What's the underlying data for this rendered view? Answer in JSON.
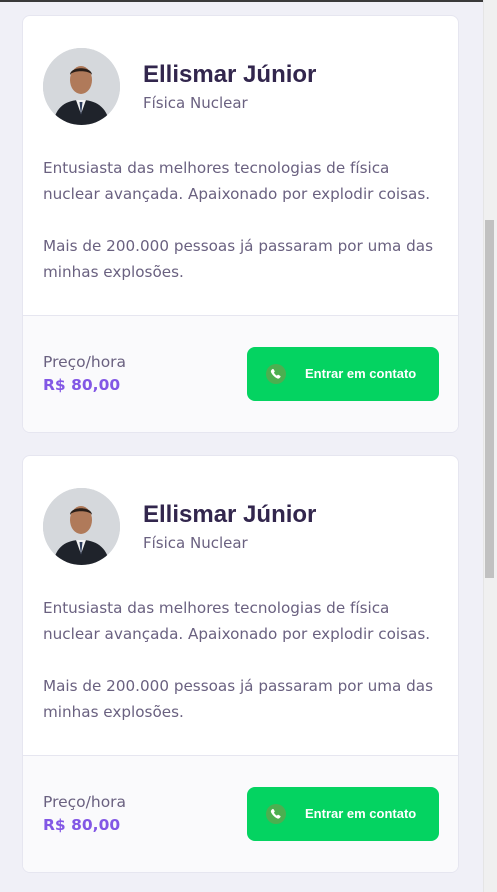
{
  "teachers": [
    {
      "name": "Ellismar Júnior",
      "subject": "Física Nuclear",
      "bio": [
        "Entusiasta das melhores tecnologias de física nuclear avançada. Apaixonado por explodir coisas.",
        "Mais de 200.000 pessoas já passaram por uma das minhas explosões."
      ],
      "price_label": "Preço/hora",
      "price_value": "R$ 80,00",
      "contact_label": "Entrar em contato"
    },
    {
      "name": "Ellismar Júnior",
      "subject": "Física Nuclear",
      "bio": [
        "Entusiasta das melhores tecnologias de física nuclear avançada. Apaixonado por explodir coisas.",
        "Mais de 200.000 pessoas já passaram por uma das minhas explosões."
      ],
      "price_label": "Preço/hora",
      "price_value": "R$ 80,00",
      "contact_label": "Entrar em contato"
    }
  ],
  "icons": {
    "avatar": "teacher-photo",
    "contact": "whatsapp-icon"
  },
  "colors": {
    "accent": "#8257e5",
    "button": "#04d361",
    "title": "#32264d",
    "text": "#6a6180"
  }
}
